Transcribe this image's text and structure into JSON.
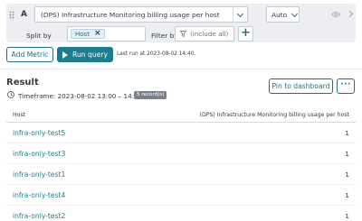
{
  "query": {
    "series_letter": "A",
    "metric": "(DPS) Infrastructure Monitoring billing usage per host",
    "aggregation": "Auto",
    "split_label": "Split by",
    "split_value": "Host",
    "filter_label": "Filter by",
    "filter_placeholder": "(include all)",
    "add_symbol": "+"
  },
  "toolbar": {
    "add_metric_label": "Add Metric",
    "run_query_label": "Run query",
    "last_run": "Last run at 2023-08-02 14:40."
  },
  "result": {
    "title": "Result",
    "timeframe": "Timeframe: 2023-08-02 13:00 – 14:00",
    "records_badge": "5 record(s)",
    "pin_label": "Pin to dashboard",
    "more_label": "···"
  },
  "table": {
    "columns": [
      "Host",
      "(DPS) Infrastructure Monitoring billing usage per host"
    ],
    "rows": [
      {
        "host": "infra-only-test5",
        "value": "1"
      },
      {
        "host": "infra-only-test3",
        "value": "1"
      },
      {
        "host": "infra-only-test1",
        "value": "1"
      },
      {
        "host": "infra-only-test4",
        "value": "1"
      },
      {
        "host": "infra-only-test2",
        "value": "1"
      }
    ]
  },
  "colors": {
    "accent": "#1c7d8e",
    "panel_bg": "#eceef1"
  }
}
